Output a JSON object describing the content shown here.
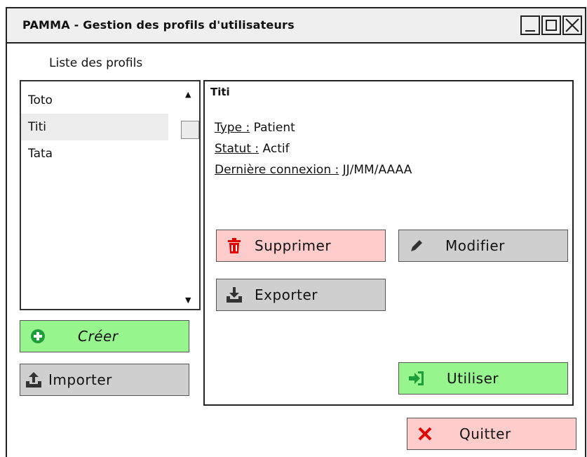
{
  "window": {
    "title": "PAMMA - Gestion des profils d'utilisateurs"
  },
  "profiles": {
    "label": "Liste des profils",
    "items": [
      "Toto",
      "Titi",
      "Tata"
    ],
    "selected": "Titi"
  },
  "details": {
    "name": "Titi",
    "type_label": "Type :",
    "type_value": " Patient",
    "status_label": "Statut :",
    "status_value": " Actif",
    "last_login_label": "Dernière connexion :",
    "last_login_value": " JJ/MM/AAAA"
  },
  "buttons": {
    "delete": "Supprimer",
    "edit": "Modifier",
    "export": "Exporter",
    "use": "Utiliser",
    "create": "Créer",
    "import": "Importer",
    "quit": "Quitter"
  },
  "colors": {
    "green": "#96f58c",
    "grey": "#cfcfcf",
    "pink": "#ffcccc",
    "red_icon": "#e00000",
    "green_icon": "#1e9e3a"
  },
  "icons": {
    "delete": "trash-icon",
    "edit": "pencil-icon",
    "export": "download-icon",
    "use": "sign-in-icon",
    "create": "plus-circle-icon",
    "import": "upload-icon",
    "quit": "x-icon"
  }
}
